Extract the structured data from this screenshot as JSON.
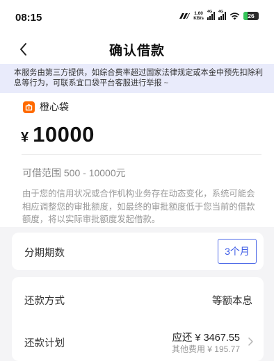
{
  "status_bar": {
    "time": "08:15",
    "net_speed_value": "1.60",
    "net_speed_unit": "KB/s",
    "signal_tag_1": "4G",
    "signal_tag_2": "4G",
    "battery": "26",
    "icons": [
      "vpn-icon",
      "signal-icon",
      "signal-icon",
      "wifi-icon",
      "battery-icon"
    ]
  },
  "nav": {
    "back_icon": "chevron-left-icon",
    "title": "确认借款"
  },
  "notice": {
    "text": "本服务由第三方提供，如综合费率超过国家法律规定或本金中预先扣除利息等行为，可联系宜口袋平台客服进行举报 ~"
  },
  "loan": {
    "provider_name": "橙心袋",
    "provider_logo_color": "#ff6a00",
    "currency": "¥",
    "amount": "10000",
    "range_text": "可借范围 500 - 10000元",
    "description": "由于您的信用状况或合作机构业务存在动态变化，系统可能会相应调整您的审批额度，如最终的审批额度低于您当前的借款额度，将以实际审批额度发起借款。"
  },
  "term": {
    "label": "分期期数",
    "selected": "3个月"
  },
  "repay": {
    "method_label": "还款方式",
    "method_value": "等额本息",
    "plan_label": "还款计划",
    "plan_amount": "应还 ¥ 3467.55",
    "plan_fee": "其他费用 ¥ 195.77"
  },
  "colors": {
    "accent": "#3e5ce6",
    "notice_bg": "#e9ebfb",
    "page_bg": "#f4f4f6"
  }
}
